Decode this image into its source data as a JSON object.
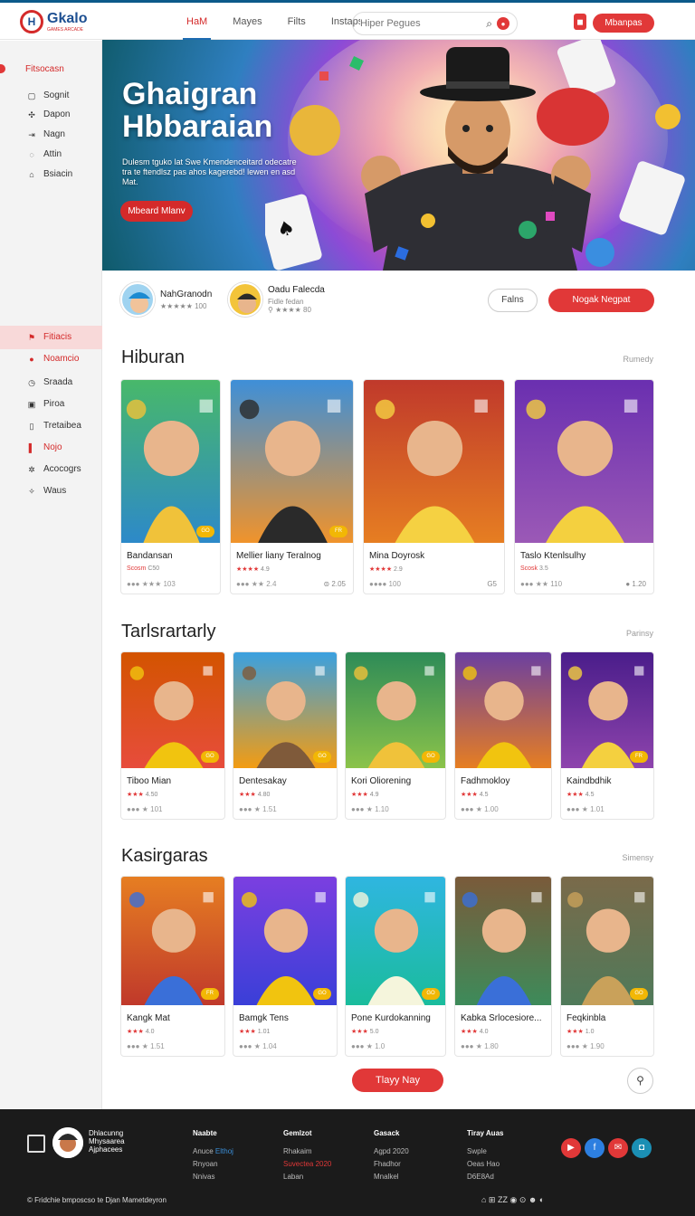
{
  "header": {
    "logo_mark": "H",
    "logo_text": "Gkalo",
    "logo_sub": "GAMES ARCADE",
    "nav": [
      "HaM",
      "Mayes",
      "Filts",
      "Instaps"
    ],
    "search_placeholder": "Hiper Pegues",
    "signup_label": "Mbanpas"
  },
  "sidebar": {
    "top_label": "Fitsocasn",
    "top_items": [
      {
        "icon": "monitor-icon",
        "glyph": "▢",
        "label": "Sognit"
      },
      {
        "icon": "puzzle-icon",
        "glyph": "✣",
        "label": "Dapon"
      },
      {
        "icon": "door-icon",
        "glyph": "⇥",
        "label": "Nagn"
      },
      {
        "icon": "chat-icon",
        "glyph": "◌",
        "label": "Attin"
      },
      {
        "icon": "bag-icon",
        "glyph": "⌂",
        "label": "Bsiacin"
      }
    ],
    "bottom_items": [
      {
        "icon": "flag-icon",
        "glyph": "⚑",
        "label": "Fitiacis",
        "selected": true
      },
      {
        "icon": "record-icon",
        "glyph": "●",
        "label": "Noamcio",
        "red": true
      },
      {
        "icon": "clock-icon",
        "glyph": "◷",
        "label": "Sraada"
      },
      {
        "icon": "screen-icon",
        "glyph": "▣",
        "label": "Piroa"
      },
      {
        "icon": "tablet-icon",
        "glyph": "▯",
        "label": "Tretaibea"
      },
      {
        "icon": "bookmark-icon",
        "glyph": "▌",
        "label": "Nojo",
        "red": true
      },
      {
        "icon": "gear-icon",
        "glyph": "✲",
        "label": "Acocogrs"
      },
      {
        "icon": "compass-icon",
        "glyph": "✧",
        "label": "Waus"
      }
    ]
  },
  "hero": {
    "title": "Ghaigran Hbbaraian",
    "subtitle": "Dulesm tguko lat Swe Kmendenceitard odecatre tra te ftendlsz pas ahos kagerebd! lewen en asd Mat.",
    "button": "Mbeard Mlanv"
  },
  "creators": [
    {
      "name": "NahGranodn",
      "meta": "★★★★★ 100"
    },
    {
      "name": "Oadu Falecda",
      "meta": "Fidle fedan\n⚲ ★★★★ 80"
    }
  ],
  "follow_label": "Falns",
  "join_label": "Nogak Negpat",
  "sections": [
    {
      "title": "Hiburan",
      "more": "Rumedy",
      "cards": [
        {
          "title": "Bandansan",
          "rate": "Scosm ",
          "rate_n": "C50",
          "stats": "●●● ★★★ 103",
          "tail": "",
          "badge": "GO"
        },
        {
          "title": "Mellier liany Teralnog",
          "rate": "★★★★ ",
          "rate_n": "4.9",
          "stats": "●●● ★★ 2.4",
          "tail": "⊜ 2.05",
          "badge": "FR"
        },
        {
          "title": "Mina Doyrosk",
          "rate": "★★★★ ",
          "rate_n": "2.9",
          "stats": "●●●● 100",
          "tail": "G5",
          "badge": ""
        },
        {
          "title": "Taslo Ktenlsulhy",
          "rate": "Scosk ",
          "rate_n": "3.5",
          "stats": "●●● ★★ 110",
          "tail": "● 1.20",
          "badge": ""
        }
      ]
    },
    {
      "title": "Tarlsrartarly",
      "more": "Parinsy",
      "cards": [
        {
          "title": "Tiboo Mian",
          "rate": "★★★ ",
          "rate_n": "4.50",
          "stats": "●●● ★ 101",
          "badge": "GO"
        },
        {
          "title": "Dentesakay",
          "rate": "★★★ ",
          "rate_n": "4.80",
          "stats": "●●● ★ 1.51",
          "badge": "GO"
        },
        {
          "title": "Kori Oliorening",
          "rate": "★★★ ",
          "rate_n": "4.9",
          "stats": "●●● ★ 1.10",
          "badge": "GO"
        },
        {
          "title": "Fadhmokloy",
          "rate": "★★★ ",
          "rate_n": "4.5",
          "stats": "●●● ★ 1.00",
          "badge": ""
        },
        {
          "title": "Kaindbdhik",
          "rate": "★★★ ",
          "rate_n": "4.5",
          "stats": "●●● ★ 1.01",
          "badge": "FR"
        }
      ]
    },
    {
      "title": "Kasirgaras",
      "more": "Simensy",
      "cards": [
        {
          "title": "Kangk Mat",
          "rate": "★★★ ",
          "rate_n": "4.0",
          "stats": "●●● ★ 1.51",
          "badge": "FR"
        },
        {
          "title": "Bamgk Tens",
          "rate": "★★★ ",
          "rate_n": "1.01",
          "stats": "●●● ★ 1.04",
          "badge": "GO"
        },
        {
          "title": "Pone Kurdokanning",
          "rate": "★★★ ",
          "rate_n": "5.0",
          "stats": "●●● ★ 1.0",
          "badge": "GO"
        },
        {
          "title": "Kabka Srlocesiore...",
          "rate": "★★★ ",
          "rate_n": "4.0",
          "stats": "●●● ★ 1.80",
          "badge": ""
        },
        {
          "title": "Feqkinbla",
          "rate": "★★★ ",
          "rate_n": "1.0",
          "stats": "●●● ★ 1.90",
          "badge": "GO"
        }
      ]
    }
  ],
  "load_more": "Tlayy Nay",
  "footer": {
    "brand": "Dhlacunng Mhysaarea Ajphacees",
    "cols": [
      {
        "title": "Naabte",
        "lines": [
          "Anuce",
          "Rnyoan",
          "Nnivas"
        ],
        "accent": "Elthoj"
      },
      {
        "title": "Gemlzot",
        "lines": [
          "Rhakaim",
          "Laban"
        ],
        "accent": "Suvectea 2020"
      },
      {
        "title": "Gasack",
        "lines": [
          "Agpd 2020",
          "Fhadhor",
          "Mnalkel"
        ]
      },
      {
        "title": "Tiray Auas",
        "lines": [
          "Swple",
          "Oeas Hao",
          "D6E8Ad"
        ]
      }
    ],
    "copyright": "© Fridchie bmposcso te Djan Mametdeyron",
    "bottom_icons": "⌂  ⊞  ZZ  ◉  ⊙  ☻  ◐"
  },
  "colors": {
    "accent": "#e13838",
    "brand": "#1d4f91"
  }
}
